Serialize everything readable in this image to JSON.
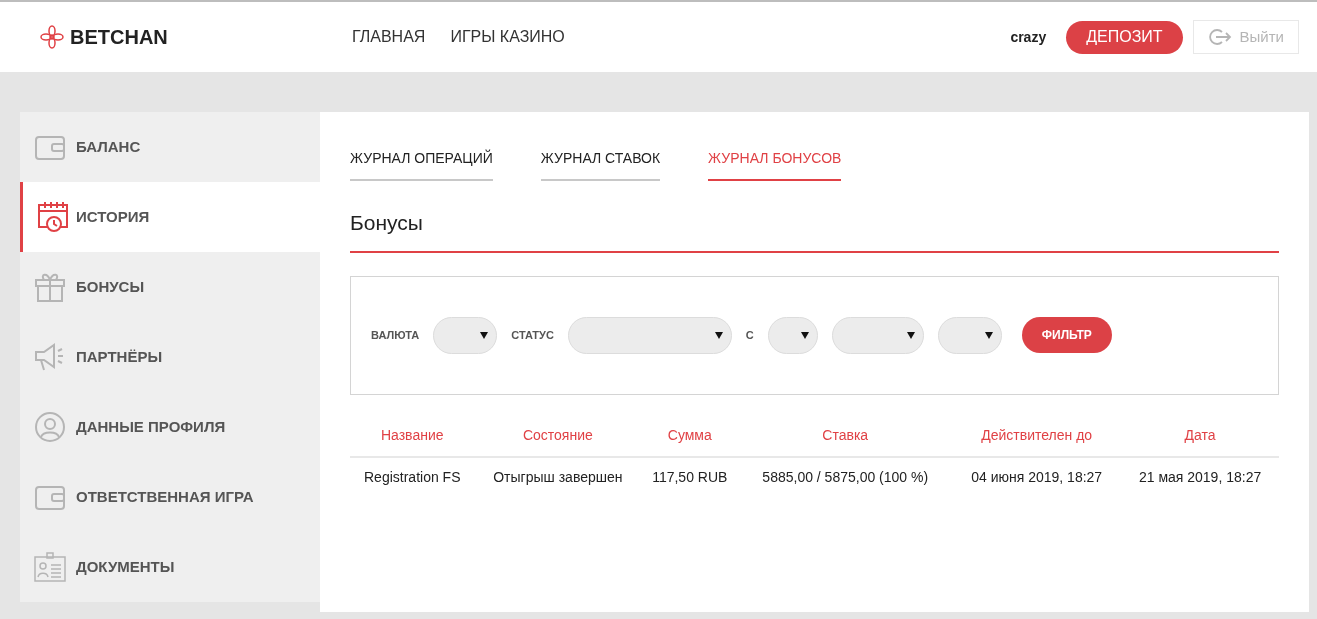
{
  "header": {
    "logo": "BETCHAN",
    "nav": [
      "ГЛАВНАЯ",
      "ИГРЫ КАЗИНО"
    ],
    "username": "crazy",
    "deposit_button": "ДЕПОЗИТ",
    "logout_button": "Выйти"
  },
  "sidebar": {
    "items": [
      {
        "label": "БАЛАНС",
        "selected": false
      },
      {
        "label": "ИСТОРИЯ",
        "selected": true
      },
      {
        "label": "БОНУСЫ",
        "selected": false
      },
      {
        "label": "ПАРТНЁРЫ",
        "selected": false
      },
      {
        "label": "ДАННЫЕ ПРОФИЛЯ",
        "selected": false
      },
      {
        "label": "ОТВЕТСТВЕННАЯ ИГРА",
        "selected": false
      },
      {
        "label": "ДОКУМЕНТЫ",
        "selected": false
      }
    ]
  },
  "tabs": [
    {
      "label": "ЖУРНАЛ ОПЕРАЦИЙ",
      "selected": false
    },
    {
      "label": "ЖУРНАЛ СТАВОК",
      "selected": false
    },
    {
      "label": "ЖУРНАЛ БОНУСОВ",
      "selected": true
    }
  ],
  "section_title": "Бонусы",
  "filter": {
    "items": [
      {
        "kind": "label",
        "text": "ВАЛЮТА"
      },
      {
        "kind": "select"
      },
      {
        "kind": "label",
        "text": "СТАТУС"
      },
      {
        "kind": "select"
      },
      {
        "kind": "label",
        "text": "С"
      },
      {
        "kind": "select"
      },
      {
        "kind": "select"
      },
      {
        "kind": "select"
      }
    ],
    "button": "ФИЛЬТР"
  },
  "table": {
    "columns": [
      "Название",
      "Состояние",
      "Сумма",
      "Ставка",
      "Действителен до",
      "Дата"
    ],
    "rows": [
      [
        "Registration FS",
        "Отыгрыш завершен",
        "117,50 RUB",
        "5885,00 / 5875,00 (100 %)",
        "04 июня 2019, 18:27",
        "21 мая 2019, 18:27"
      ]
    ]
  }
}
